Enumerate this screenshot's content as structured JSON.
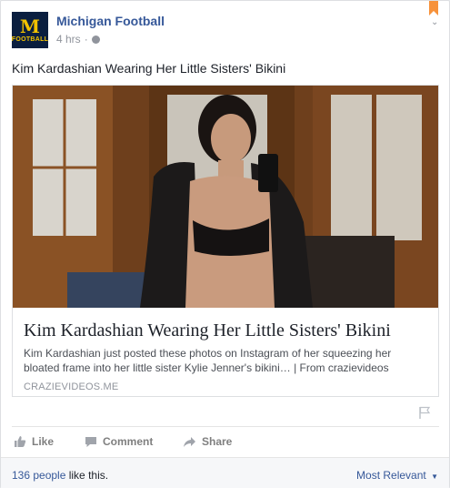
{
  "post": {
    "page_name": "Michigan Football",
    "time": "4 hrs",
    "separator": "·",
    "text": "Kim Kardashian Wearing Her Little Sisters' Bikini",
    "avatar": {
      "letter": "M",
      "caption": "FOOTBALL",
      "bg": "#0a1e3f",
      "fg": "#f2c200"
    }
  },
  "link_preview": {
    "title": "Kim Kardashian Wearing Her Little Sisters' Bikini",
    "description": "Kim Kardashian just posted these photos on Instagram of her squeezing her bloated frame into her little sister Kylie Jenner's bikini… | From crazievideos",
    "domain": "CRAZIEVIDEOS.ME",
    "image_icon": "selfie-photo"
  },
  "actions": {
    "like": "Like",
    "comment": "Comment",
    "share": "Share"
  },
  "footer": {
    "likes_count": "136 people",
    "likes_suffix": " like this.",
    "sort": "Most Relevant"
  },
  "icons": [
    "globe-icon",
    "bookmark-icon",
    "chevron-down-icon",
    "flag-icon",
    "like-icon",
    "comment-icon",
    "share-icon",
    "caret-down-icon"
  ],
  "colors": {
    "link": "#365899",
    "muted": "#90949c",
    "bookmark": "#f7923b"
  }
}
